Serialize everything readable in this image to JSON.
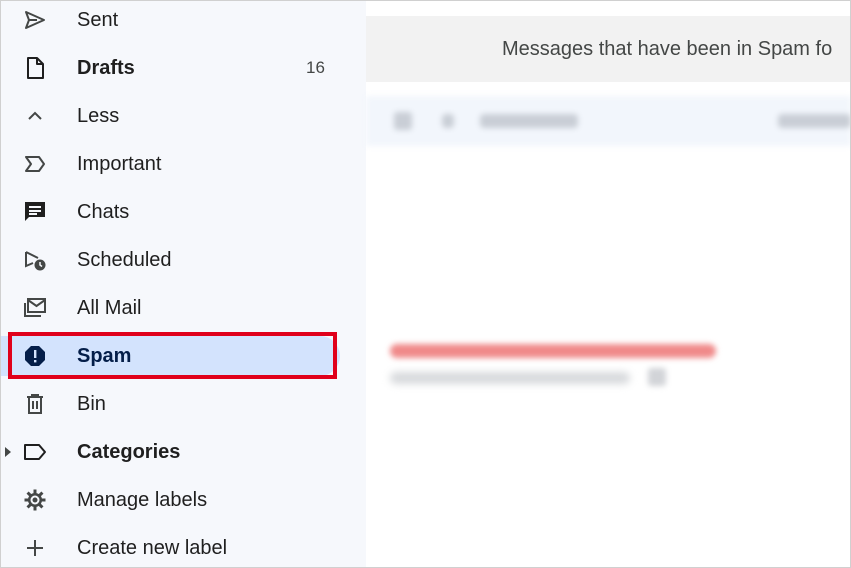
{
  "sidebar": {
    "items": [
      {
        "label": "Sent",
        "icon": "send-icon"
      },
      {
        "label": "Drafts",
        "icon": "draft-icon",
        "count": "16",
        "bold": true
      },
      {
        "label": "Less",
        "icon": "chevron-up-icon"
      },
      {
        "label": "Important",
        "icon": "important-icon"
      },
      {
        "label": "Chats",
        "icon": "chat-icon"
      },
      {
        "label": "Scheduled",
        "icon": "scheduled-icon"
      },
      {
        "label": "All Mail",
        "icon": "all-mail-icon"
      },
      {
        "label": "Spam",
        "icon": "spam-icon",
        "active": true
      },
      {
        "label": "Bin",
        "icon": "trash-icon"
      },
      {
        "label": "Categories",
        "icon": "label-icon",
        "bold": true
      },
      {
        "label": "Manage labels",
        "icon": "gear-icon"
      },
      {
        "label": "Create new label",
        "icon": "plus-icon"
      }
    ]
  },
  "main": {
    "banner_text": "Messages that have been in Spam fo"
  },
  "colors": {
    "highlight": "#e0001b",
    "active_bg": "#d3e3fd",
    "sidebar_bg": "#f6f8fc"
  }
}
